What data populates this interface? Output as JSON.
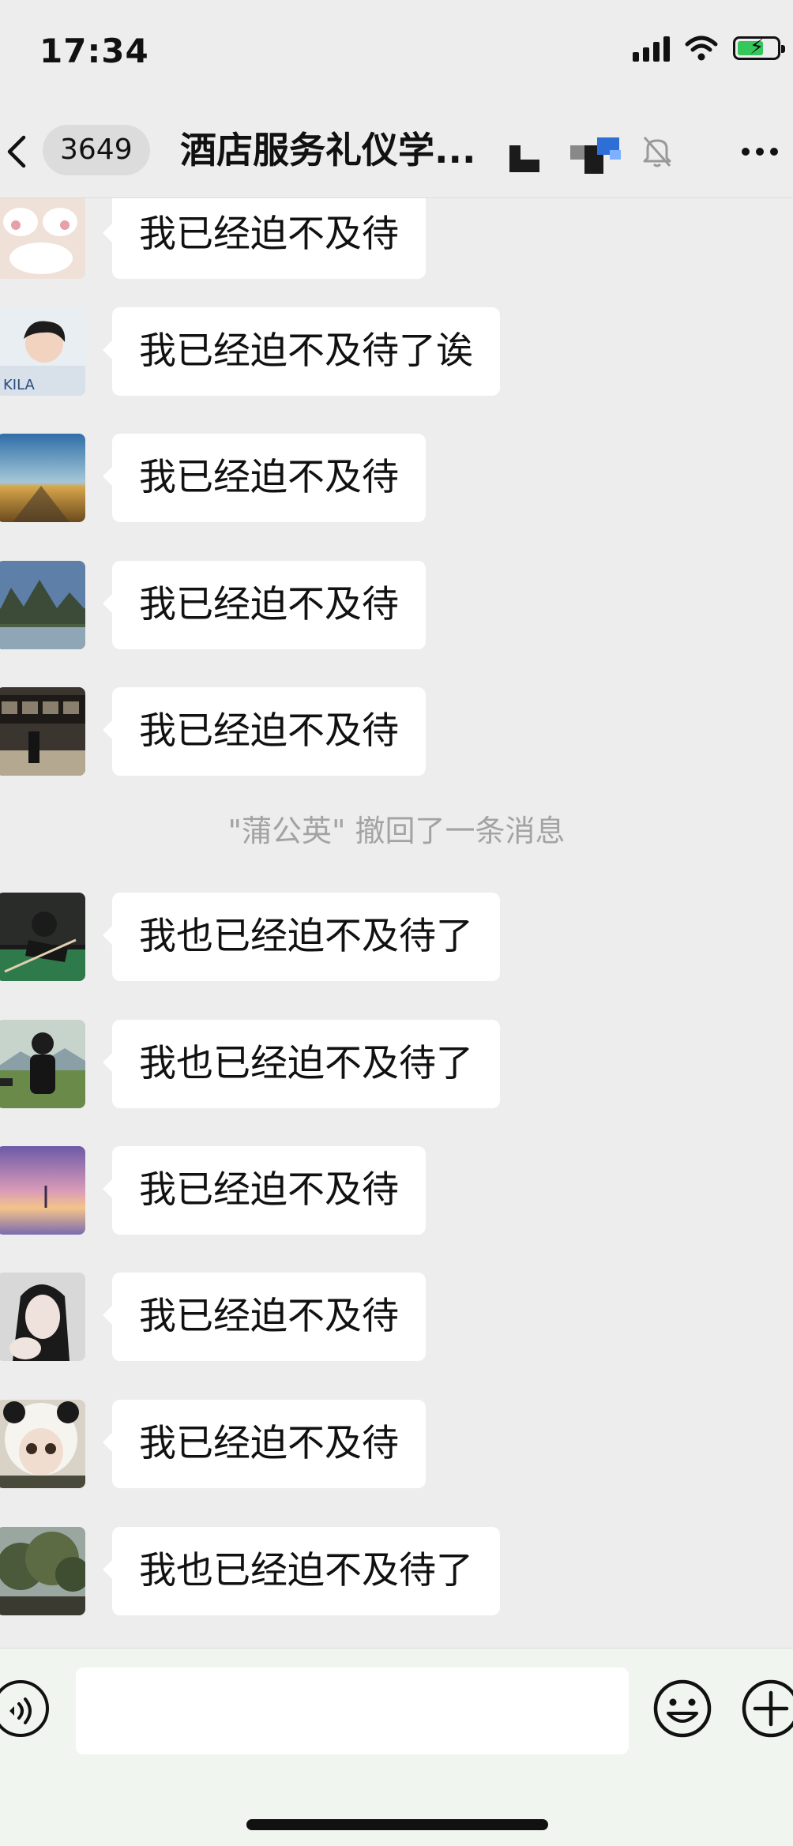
{
  "status_bar": {
    "time": "17:34"
  },
  "nav": {
    "unread_count": "3649",
    "title": "酒店服务礼仪学..."
  },
  "messages": [
    {
      "text": "我已经迫不及待",
      "avatar": "cat-paw-avatar"
    },
    {
      "text": "我已经迫不及待了诶",
      "avatar": "boy-portrait-avatar"
    },
    {
      "text": "我已经迫不及待",
      "avatar": "sunset-road-avatar"
    },
    {
      "text": "我已经迫不及待",
      "avatar": "mountain-lake-avatar"
    },
    {
      "text": "我已经迫不及待",
      "avatar": "train-platform-avatar"
    },
    {
      "text": "我也已经迫不及待了",
      "avatar": "billiards-avatar"
    },
    {
      "text": "我也已经迫不及待了",
      "avatar": "person-in-field-avatar"
    },
    {
      "text": "我已经迫不及待",
      "avatar": "purple-sunset-avatar"
    },
    {
      "text": "我已经迫不及待",
      "avatar": "girl-selfie-avatar"
    },
    {
      "text": "我已经迫不及待",
      "avatar": "panda-hat-girl-avatar"
    },
    {
      "text": "我也已经迫不及待了",
      "avatar": "tree-landscape-avatar"
    }
  ],
  "system_notice": "\"蒲公英\" 撤回了一条消息",
  "input": {
    "value": "",
    "placeholder": ""
  },
  "icons": [
    "back-arrow-icon",
    "mute-bell-icon",
    "more-icon",
    "voice-icon",
    "emoji-icon",
    "plus-icon",
    "wifi-icon",
    "signal-icon",
    "battery-icon"
  ]
}
